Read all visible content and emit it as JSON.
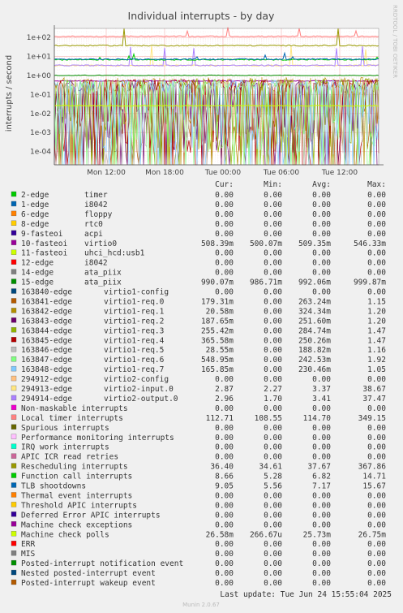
{
  "chart_data": {
    "type": "line",
    "title": "Individual interrupts - by day",
    "ylabel": "interrupts / second",
    "y_scale": "log",
    "ylim": [
      2e-05,
      300
    ],
    "y_ticks": [
      {
        "label": "1e+02",
        "value": 100
      },
      {
        "label": "1e+01",
        "value": 10
      },
      {
        "label": "1e+00",
        "value": 1
      },
      {
        "label": "1e-01",
        "value": 0.1
      },
      {
        "label": "1e-02",
        "value": 0.01
      },
      {
        "label": "1e-03",
        "value": 0.001
      },
      {
        "label": "1e-04",
        "value": 0.0001
      }
    ],
    "x_ticks": [
      "Mon 12:00",
      "Mon 18:00",
      "Tue 00:00",
      "Tue 06:00",
      "Tue 12:00"
    ],
    "side_label": "RRDTOOL / TOBI OETIKER",
    "grid": true,
    "columns": [
      "Cur:",
      "Min:",
      "Avg:",
      "Max:"
    ],
    "series": [
      {
        "name": "2-edge",
        "desc": "timer",
        "color": "#00cc00",
        "cur": "0.00",
        "min": "0.00",
        "avg": "0.00",
        "max": "0.00"
      },
      {
        "name": "1-edge",
        "desc": "i8042",
        "color": "#0066b3",
        "cur": "0.00",
        "min": "0.00",
        "avg": "0.00",
        "max": "0.00"
      },
      {
        "name": "6-edge",
        "desc": "floppy",
        "color": "#ff8000",
        "cur": "0.00",
        "min": "0.00",
        "avg": "0.00",
        "max": "0.00"
      },
      {
        "name": "8-edge",
        "desc": "rtc0",
        "color": "#ffcc00",
        "cur": "0.00",
        "min": "0.00",
        "avg": "0.00",
        "max": "0.00"
      },
      {
        "name": "9-fasteoi",
        "desc": "acpi",
        "color": "#330099",
        "cur": "0.00",
        "min": "0.00",
        "avg": "0.00",
        "max": "0.00"
      },
      {
        "name": "10-fasteoi",
        "desc": "virtio0",
        "color": "#990099",
        "cur": "508.39m",
        "min": "500.07m",
        "avg": "509.35m",
        "max": "546.33m"
      },
      {
        "name": "11-fasteoi",
        "desc": "uhci_hcd:usb1",
        "color": "#ccff00",
        "cur": "0.00",
        "min": "0.00",
        "avg": "0.00",
        "max": "0.00"
      },
      {
        "name": "12-edge",
        "desc": "i8042",
        "color": "#ff0000",
        "cur": "0.00",
        "min": "0.00",
        "avg": "0.00",
        "max": "0.00"
      },
      {
        "name": "14-edge",
        "desc": "ata_piix",
        "color": "#808080",
        "cur": "0.00",
        "min": "0.00",
        "avg": "0.00",
        "max": "0.00"
      },
      {
        "name": "15-edge",
        "desc": "ata_piix",
        "color": "#008f00",
        "cur": "990.07m",
        "min": "986.71m",
        "avg": "992.06m",
        "max": "999.87m"
      },
      {
        "name": "163840-edge",
        "desc": "virtio1-config",
        "color": "#00487d",
        "cur": "0.00",
        "min": "0.00",
        "avg": "0.00",
        "max": "0.00"
      },
      {
        "name": "163841-edge",
        "desc": "virtio1-req.0",
        "color": "#b35a00",
        "cur": "179.31m",
        "min": "0.00",
        "avg": "263.24m",
        "max": "1.15"
      },
      {
        "name": "163842-edge",
        "desc": "virtio1-req.1",
        "color": "#b38f00",
        "cur": "20.58m",
        "min": "0.00",
        "avg": "324.34m",
        "max": "1.20"
      },
      {
        "name": "163843-edge",
        "desc": "virtio1-req.2",
        "color": "#6b006b",
        "cur": "187.65m",
        "min": "0.00",
        "avg": "251.60m",
        "max": "1.20"
      },
      {
        "name": "163844-edge",
        "desc": "virtio1-req.3",
        "color": "#8fb300",
        "cur": "255.42m",
        "min": "0.00",
        "avg": "284.74m",
        "max": "1.47"
      },
      {
        "name": "163845-edge",
        "desc": "virtio1-req.4",
        "color": "#b30000",
        "cur": "365.58m",
        "min": "0.00",
        "avg": "250.26m",
        "max": "1.47"
      },
      {
        "name": "163846-edge",
        "desc": "virtio1-req.5",
        "color": "#bebebe",
        "cur": "28.55m",
        "min": "0.00",
        "avg": "188.82m",
        "max": "1.16"
      },
      {
        "name": "163847-edge",
        "desc": "virtio1-req.6",
        "color": "#80ff80",
        "cur": "548.95m",
        "min": "0.00",
        "avg": "242.53m",
        "max": "1.92"
      },
      {
        "name": "163848-edge",
        "desc": "virtio1-req.7",
        "color": "#80c9ff",
        "cur": "165.85m",
        "min": "0.00",
        "avg": "230.46m",
        "max": "1.05"
      },
      {
        "name": "294912-edge",
        "desc": "virtio2-config",
        "color": "#ffc080",
        "cur": "0.00",
        "min": "0.00",
        "avg": "0.00",
        "max": "0.00"
      },
      {
        "name": "294913-edge",
        "desc": "virtio2-input.0",
        "color": "#ffe680",
        "cur": "2.87",
        "min": "2.27",
        "avg": "3.37",
        "max": "38.67"
      },
      {
        "name": "294914-edge",
        "desc": "virtio2-output.0",
        "color": "#aa80ff",
        "cur": "2.96",
        "min": "1.70",
        "avg": "3.41",
        "max": "37.47"
      },
      {
        "name": "Non-maskable interrupts",
        "desc": "",
        "color": "#ee00cc",
        "cur": "0.00",
        "min": "0.00",
        "avg": "0.00",
        "max": "0.00"
      },
      {
        "name": "Local timer interrupts",
        "desc": "",
        "color": "#ff8080",
        "cur": "112.71",
        "min": "108.55",
        "avg": "114.70",
        "max": "349.15"
      },
      {
        "name": "Spurious interrupts",
        "desc": "",
        "color": "#666600",
        "cur": "0.00",
        "min": "0.00",
        "avg": "0.00",
        "max": "0.00"
      },
      {
        "name": "Performance monitoring interrupts",
        "desc": "",
        "color": "#ffbfff",
        "cur": "0.00",
        "min": "0.00",
        "avg": "0.00",
        "max": "0.00"
      },
      {
        "name": "IRQ work interrupts",
        "desc": "",
        "color": "#00ffcc",
        "cur": "0.00",
        "min": "0.00",
        "avg": "0.00",
        "max": "0.00"
      },
      {
        "name": "APIC ICR read retries",
        "desc": "",
        "color": "#cc6699",
        "cur": "0.00",
        "min": "0.00",
        "avg": "0.00",
        "max": "0.00"
      },
      {
        "name": "Rescheduling interrupts",
        "desc": "",
        "color": "#999900",
        "cur": "36.40",
        "min": "34.61",
        "avg": "37.67",
        "max": "367.86"
      },
      {
        "name": "Function call interrupts",
        "desc": "",
        "color": "#00cc00",
        "cur": "8.66",
        "min": "5.28",
        "avg": "6.82",
        "max": "14.71"
      },
      {
        "name": "TLB shootdowns",
        "desc": "",
        "color": "#0066b3",
        "cur": "9.05",
        "min": "5.56",
        "avg": "7.17",
        "max": "15.67"
      },
      {
        "name": "Thermal event interrupts",
        "desc": "",
        "color": "#ff8000",
        "cur": "0.00",
        "min": "0.00",
        "avg": "0.00",
        "max": "0.00"
      },
      {
        "name": "Threshold APIC interrupts",
        "desc": "",
        "color": "#ffcc00",
        "cur": "0.00",
        "min": "0.00",
        "avg": "0.00",
        "max": "0.00"
      },
      {
        "name": "Deferred Error APIC interrupts",
        "desc": "",
        "color": "#330099",
        "cur": "0.00",
        "min": "0.00",
        "avg": "0.00",
        "max": "0.00"
      },
      {
        "name": "Machine check exceptions",
        "desc": "",
        "color": "#990099",
        "cur": "0.00",
        "min": "0.00",
        "avg": "0.00",
        "max": "0.00"
      },
      {
        "name": "Machine check polls",
        "desc": "",
        "color": "#ccff00",
        "cur": "26.58m",
        "min": "266.67u",
        "avg": "25.73m",
        "max": "26.75m"
      },
      {
        "name": "ERR",
        "desc": "",
        "color": "#ff0000",
        "cur": "0.00",
        "min": "0.00",
        "avg": "0.00",
        "max": "0.00"
      },
      {
        "name": "MIS",
        "desc": "",
        "color": "#808080",
        "cur": "0.00",
        "min": "0.00",
        "avg": "0.00",
        "max": "0.00"
      },
      {
        "name": "Posted-interrupt notification event",
        "desc": "",
        "color": "#008f00",
        "cur": "0.00",
        "min": "0.00",
        "avg": "0.00",
        "max": "0.00"
      },
      {
        "name": "Nested posted-interrupt event",
        "desc": "",
        "color": "#00487d",
        "cur": "0.00",
        "min": "0.00",
        "avg": "0.00",
        "max": "0.00"
      },
      {
        "name": "Posted-interrupt wakeup event",
        "desc": "",
        "color": "#b35a00",
        "cur": "0.00",
        "min": "0.00",
        "avg": "0.00",
        "max": "0.00"
      }
    ],
    "last_update": "Last update: Tue Jun 24 15:55:04 2025",
    "footer": "Munin 2.0.67"
  }
}
